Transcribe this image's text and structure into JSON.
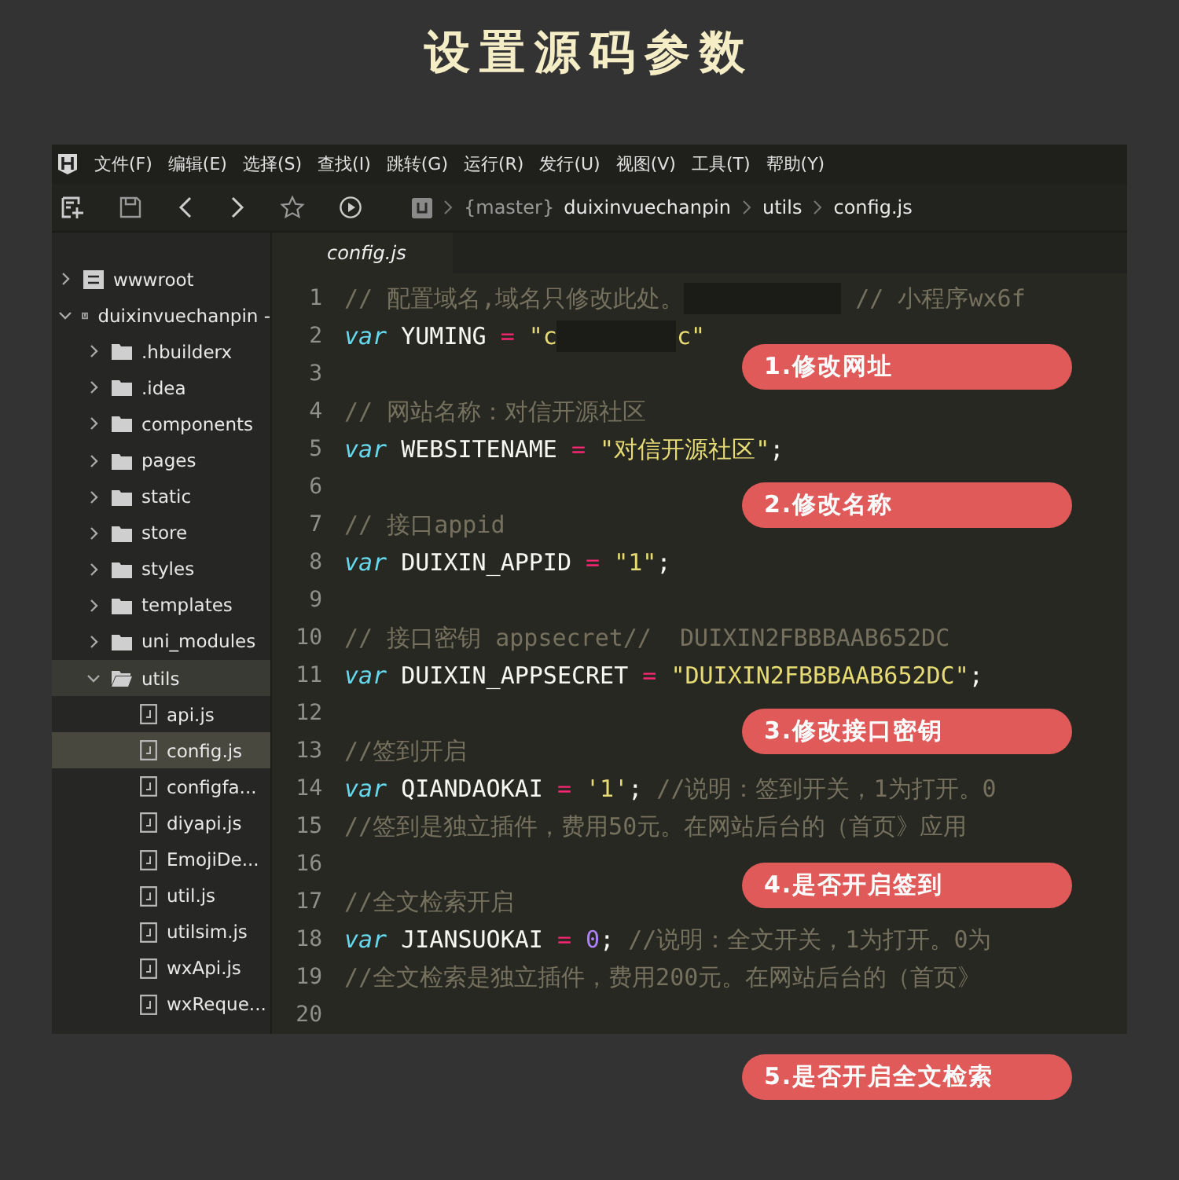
{
  "title": "设置源码参数",
  "menu": [
    "文件(F)",
    "编辑(E)",
    "选择(S)",
    "查找(I)",
    "跳转(G)",
    "运行(R)",
    "发行(U)",
    "视图(V)",
    "工具(T)",
    "帮助(Y)"
  ],
  "breadcrumb": {
    "branch": "{master}",
    "path": [
      "duixinvuechanpin",
      "utils",
      "config.js"
    ]
  },
  "tree": [
    {
      "label": "wwwroot",
      "kind": "drive",
      "expanded": false,
      "selected": false
    },
    {
      "label": "duixinvuechanpin -",
      "kind": "project",
      "expanded": true,
      "selected": false,
      "children": [
        {
          "label": ".hbuilderx",
          "kind": "folder",
          "expanded": false,
          "selected": false
        },
        {
          "label": ".idea",
          "kind": "folder",
          "expanded": false,
          "selected": false
        },
        {
          "label": "components",
          "kind": "folder",
          "expanded": false,
          "selected": false
        },
        {
          "label": "pages",
          "kind": "folder",
          "expanded": false,
          "selected": false
        },
        {
          "label": "static",
          "kind": "folder",
          "expanded": false,
          "selected": false
        },
        {
          "label": "store",
          "kind": "folder",
          "expanded": false,
          "selected": false
        },
        {
          "label": "styles",
          "kind": "folder",
          "expanded": false,
          "selected": false
        },
        {
          "label": "templates",
          "kind": "folder",
          "expanded": false,
          "selected": false
        },
        {
          "label": "uni_modules",
          "kind": "folder",
          "expanded": false,
          "selected": false
        },
        {
          "label": "utils",
          "kind": "folder",
          "expanded": true,
          "selected": true,
          "children": [
            {
              "label": "api.js",
              "kind": "file",
              "selected": false
            },
            {
              "label": "config.js",
              "kind": "file",
              "selected": true
            },
            {
              "label": "configfa...",
              "kind": "file",
              "selected": false
            },
            {
              "label": "diyapi.js",
              "kind": "file",
              "selected": false
            },
            {
              "label": "EmojiDe...",
              "kind": "file",
              "selected": false
            },
            {
              "label": "util.js",
              "kind": "file",
              "selected": false
            },
            {
              "label": "utilsim.js",
              "kind": "file",
              "selected": false
            },
            {
              "label": "wxApi.js",
              "kind": "file",
              "selected": false
            },
            {
              "label": "wxReque...",
              "kind": "file",
              "selected": false
            }
          ]
        }
      ]
    }
  ],
  "tab": {
    "label": "config.js"
  },
  "lines": [
    {
      "number": "1",
      "parts": [
        {
          "kind": "code",
          "tokens": [
            {
              "kind": "comment",
              "text": "// 配置域名,域名只修改此处。"
            }
          ]
        },
        {
          "kind": "mask_wide"
        },
        {
          "kind": "code",
          "tokens": [
            {
              "kind": "comment",
              "text": " // 小程序wx6f"
            }
          ]
        }
      ]
    },
    {
      "number": "2",
      "parts": [
        {
          "kind": "code",
          "tokens": [
            {
              "kind": "keyword",
              "text": "var"
            },
            {
              "kind": "ident",
              "text": " YUMING "
            },
            {
              "kind": "op",
              "text": "="
            },
            {
              "kind": "string",
              "text": " \"c"
            }
          ]
        },
        {
          "kind": "mask_narrow"
        },
        {
          "kind": "code",
          "tokens": [
            {
              "kind": "string",
              "text": "c\""
            }
          ]
        }
      ]
    },
    {
      "number": "3"
    },
    {
      "number": "4",
      "parts": [
        {
          "kind": "code",
          "tokens": [
            {
              "kind": "comment",
              "text": "// 网站名称：对信开源社区"
            }
          ]
        }
      ]
    },
    {
      "number": "5",
      "parts": [
        {
          "kind": "code",
          "tokens": [
            {
              "kind": "keyword",
              "text": "var"
            },
            {
              "kind": "ident",
              "text": " WEBSITENAME "
            },
            {
              "kind": "op",
              "text": "="
            },
            {
              "kind": "string",
              "text": " \"对信开源社区\""
            },
            {
              "kind": "punct",
              "text": ";"
            }
          ]
        }
      ]
    },
    {
      "number": "6"
    },
    {
      "number": "7",
      "parts": [
        {
          "kind": "code",
          "tokens": [
            {
              "kind": "comment",
              "text": "// 接口appid"
            }
          ]
        }
      ]
    },
    {
      "number": "8",
      "parts": [
        {
          "kind": "code",
          "tokens": [
            {
              "kind": "keyword",
              "text": "var"
            },
            {
              "kind": "ident",
              "text": " DUIXIN_APPID "
            },
            {
              "kind": "op",
              "text": "="
            },
            {
              "kind": "string",
              "text": " \"1\""
            },
            {
              "kind": "punct",
              "text": ";"
            }
          ]
        }
      ]
    },
    {
      "number": "9"
    },
    {
      "number": "10",
      "parts": [
        {
          "kind": "code",
          "tokens": [
            {
              "kind": "comment",
              "text": "// 接口密钥 appsecret//  DUIXIN2FBBBAAB652DC"
            }
          ]
        }
      ]
    },
    {
      "number": "11",
      "parts": [
        {
          "kind": "code",
          "tokens": [
            {
              "kind": "keyword",
              "text": "var"
            },
            {
              "kind": "ident",
              "text": " DUIXIN_APPSECRET "
            },
            {
              "kind": "op",
              "text": "="
            },
            {
              "kind": "string",
              "text": " \"DUIXIN2FBBBAAB652DC\""
            },
            {
              "kind": "punct",
              "text": ";"
            }
          ]
        }
      ]
    },
    {
      "number": "12"
    },
    {
      "number": "13",
      "parts": [
        {
          "kind": "code",
          "tokens": [
            {
              "kind": "comment",
              "text": "//签到开启"
            }
          ]
        }
      ]
    },
    {
      "number": "14",
      "parts": [
        {
          "kind": "code",
          "tokens": [
            {
              "kind": "keyword",
              "text": "var"
            },
            {
              "kind": "ident",
              "text": " QIANDAOKAI "
            },
            {
              "kind": "op",
              "text": "="
            },
            {
              "kind": "string",
              "text": " '1'"
            },
            {
              "kind": "punct",
              "text": ";"
            },
            {
              "kind": "comment",
              "text": " //说明：签到开关，1为打开。0"
            }
          ]
        }
      ]
    },
    {
      "number": "15",
      "parts": [
        {
          "kind": "code",
          "tokens": [
            {
              "kind": "comment",
              "text": "//签到是独立插件，费用50元。在网站后台的（首页》应用"
            }
          ]
        }
      ]
    },
    {
      "number": "16"
    },
    {
      "number": "17",
      "parts": [
        {
          "kind": "code",
          "tokens": [
            {
              "kind": "comment",
              "text": "//全文检索开启"
            }
          ]
        }
      ]
    },
    {
      "number": "18",
      "parts": [
        {
          "kind": "code",
          "tokens": [
            {
              "kind": "keyword",
              "text": "var"
            },
            {
              "kind": "ident",
              "text": " JIANSUOKAI "
            },
            {
              "kind": "op",
              "text": "="
            },
            {
              "kind": "number",
              "text": " 0"
            },
            {
              "kind": "punct",
              "text": ";"
            },
            {
              "kind": "comment",
              "text": " //说明：全文开关，1为打开。0为"
            }
          ]
        }
      ]
    },
    {
      "number": "19",
      "parts": [
        {
          "kind": "code",
          "tokens": [
            {
              "kind": "comment",
              "text": "//全文检索是独立插件，费用200元。在网站后台的（首页》"
            }
          ]
        }
      ]
    },
    {
      "number": "20"
    }
  ],
  "annotations": [
    "1.修改网址",
    "2.修改名称",
    "3.修改接口密钥",
    "4.是否开启签到",
    "5.是否开启全文检索"
  ]
}
